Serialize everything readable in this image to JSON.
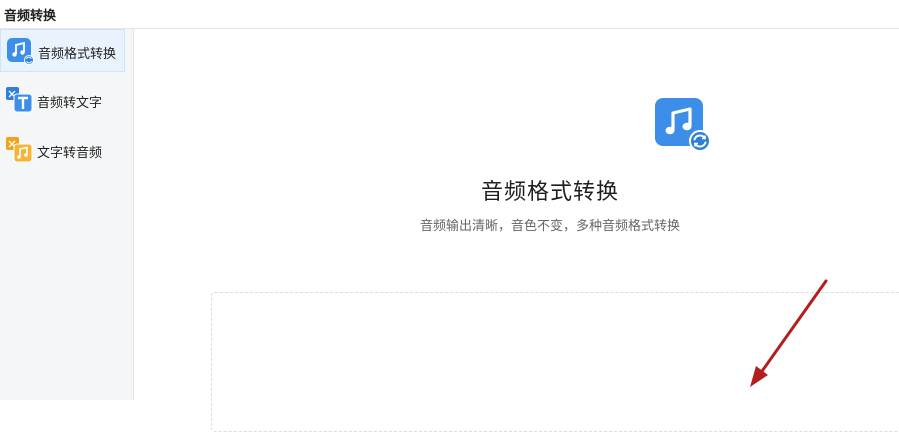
{
  "window": {
    "title": "音频转换"
  },
  "sidebar": {
    "items": [
      {
        "label": "音频格式转换",
        "icon": "audio-format-convert-icon",
        "active": true
      },
      {
        "label": "音频转文字",
        "icon": "audio-to-text-icon",
        "active": false
      },
      {
        "label": "文字转音频",
        "icon": "text-to-audio-icon",
        "active": false
      }
    ]
  },
  "main": {
    "hero_icon": "music-note-convert-icon",
    "title": "音频格式转换",
    "subtitle": "音频输出清晰，音色不变，多种音频格式转换"
  },
  "colors": {
    "accent_blue": "#3d8ee8",
    "accent_orange": "#f5a623",
    "arrow_red": "#b21e1e",
    "active_bg": "#e8f3fd"
  }
}
